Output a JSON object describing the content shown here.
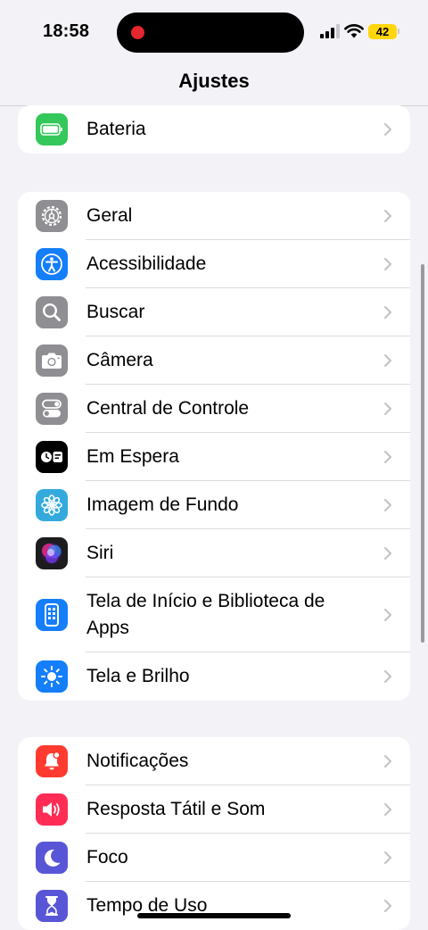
{
  "status_bar": {
    "time": "18:58",
    "battery_level": "42"
  },
  "nav": {
    "title": "Ajustes"
  },
  "groups": [
    {
      "items": [
        {
          "label": "Bateria",
          "icon": "battery-icon",
          "color": "#34c759"
        }
      ]
    },
    {
      "items": [
        {
          "label": "Geral",
          "icon": "gear-icon",
          "color": "#8e8e93"
        },
        {
          "label": "Acessibilidade",
          "icon": "accessibility-icon",
          "color": "#147efb"
        },
        {
          "label": "Buscar",
          "icon": "magnifier-icon",
          "color": "#8e8e93"
        },
        {
          "label": "Câmera",
          "icon": "camera-icon",
          "color": "#8e8e93"
        },
        {
          "label": "Central de Controle",
          "icon": "toggles-icon",
          "color": "#8e8e93"
        },
        {
          "label": "Em Espera",
          "icon": "standby-icon",
          "color": "#000000"
        },
        {
          "label": "Imagem de Fundo",
          "icon": "flower-icon",
          "color": "#34aadc"
        },
        {
          "label": "Siri",
          "icon": "siri-icon",
          "color": "#1c1c1e"
        },
        {
          "label": "Tela de Início e Biblioteca de Apps",
          "icon": "home-screen-icon",
          "color": "#147efb"
        },
        {
          "label": "Tela e Brilho",
          "icon": "sun-icon",
          "color": "#147efb"
        }
      ]
    },
    {
      "items": [
        {
          "label": "Notificações",
          "icon": "bell-icon",
          "color": "#ff3b30"
        },
        {
          "label": "Resposta Tátil e Som",
          "icon": "speaker-icon",
          "color": "#ff2d55"
        },
        {
          "label": "Foco",
          "icon": "moon-icon",
          "color": "#5856d6"
        },
        {
          "label": "Tempo de Uso",
          "icon": "hourglass-icon",
          "color": "#5856d6"
        }
      ]
    }
  ]
}
